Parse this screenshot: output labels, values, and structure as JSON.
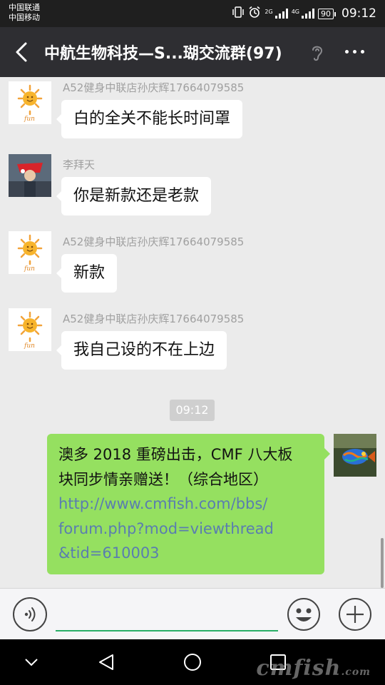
{
  "status_bar": {
    "carrier_1": "中国联通",
    "carrier_2": "中国移动",
    "signal_1_label": "2G",
    "signal_2_label": "4G",
    "battery": "90",
    "time": "09:12"
  },
  "header": {
    "title": "中航生物科技—S...瑚交流群(97)"
  },
  "messages": [
    {
      "sender": "A52健身中联店孙庆辉17664079585",
      "text": "白的全关不能长时间罩",
      "avatar": "sun-logo-avatar"
    },
    {
      "sender": "李拜天",
      "text": "你是新款还是老款",
      "avatar": "photo-avatar"
    },
    {
      "sender": "A52健身中联店孙庆辉17664079585",
      "text": "新款",
      "avatar": "sun-logo-avatar"
    },
    {
      "sender": "A52健身中联店孙庆辉17664079585",
      "text": "我自己设的不在上边",
      "avatar": "sun-logo-avatar"
    }
  ],
  "timestamp": "09:12",
  "own_message": {
    "line_1": "澳多 2018 重磅出击，CMF 八大板",
    "line_2": "块同步情亲赠送！（综合地区）",
    "link_1": "http://www.cmfish.com/bbs/",
    "link_2": "forum.php?mod=viewthread",
    "link_3": "&tid=610003"
  },
  "input": {
    "value": "",
    "placeholder": ""
  },
  "watermark": {
    "main": "cmfish",
    "suffix": ".com"
  },
  "colors": {
    "own_bubble": "#95e060",
    "link": "#5a7db0",
    "input_underline": "#2aae67",
    "title_bar": "#2e2e32"
  },
  "icons": [
    "back-arrow-icon",
    "ear-icon",
    "more-icon",
    "voice-icon",
    "emoji-icon",
    "plus-icon",
    "nav-back-icon",
    "nav-home-icon",
    "nav-recents-icon",
    "nav-down-icon"
  ]
}
